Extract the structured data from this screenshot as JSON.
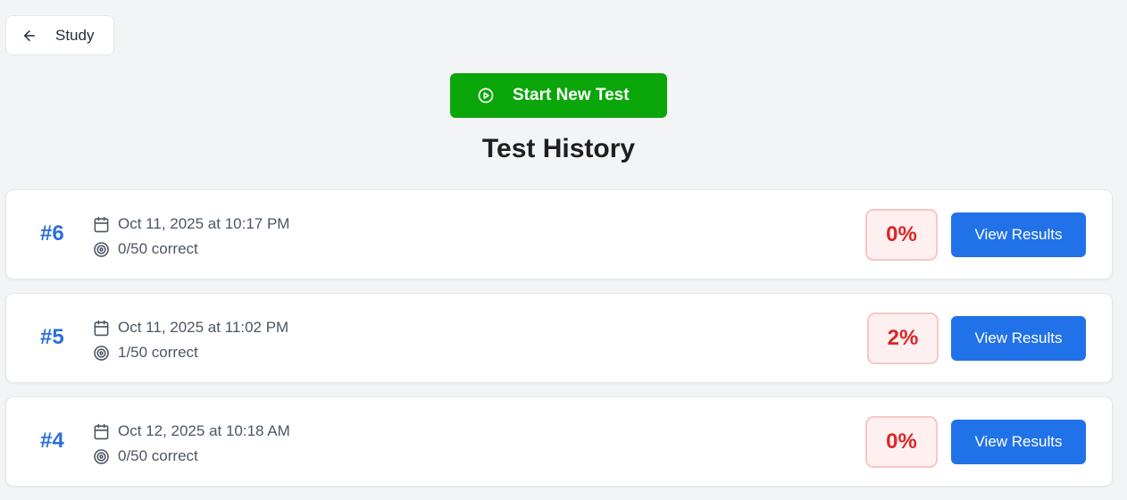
{
  "back_button": {
    "label": "Study",
    "icon": "arrow-left-icon"
  },
  "start_button": {
    "label": "Start New Test",
    "icon": "play-circle-icon",
    "color": "#0aa60a"
  },
  "page_title": "Test History",
  "colors": {
    "accent": "#2a6fdb",
    "button": "#2172e8",
    "fail": "#dc2626"
  },
  "tests": [
    {
      "number": "#6",
      "date": "Oct 11, 2025 at 10:17 PM",
      "correct": "0/50 correct",
      "score": "0%",
      "action": "View Results"
    },
    {
      "number": "#5",
      "date": "Oct 11, 2025 at 11:02 PM",
      "correct": "1/50 correct",
      "score": "2%",
      "action": "View Results"
    },
    {
      "number": "#4",
      "date": "Oct 12, 2025 at 10:18 AM",
      "correct": "0/50 correct",
      "score": "0%",
      "action": "View Results"
    }
  ]
}
